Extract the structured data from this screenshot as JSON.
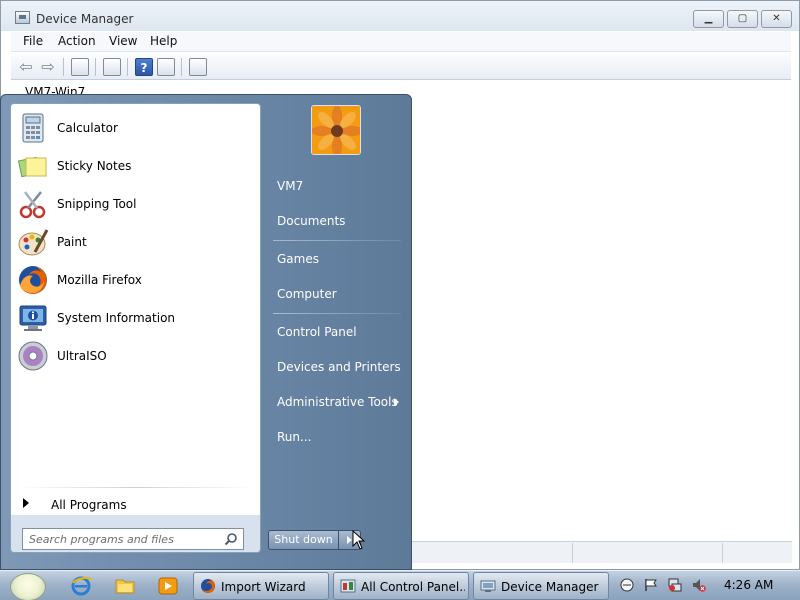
{
  "device_manager": {
    "title": "Device Manager",
    "menu": [
      "File",
      "Action",
      "View",
      "Help"
    ],
    "tree_root": "VM7-Win7",
    "buttons": {
      "minimize": "▁",
      "maximize": "▢",
      "close": "✕"
    }
  },
  "start_menu": {
    "programs": [
      {
        "label": "Calculator",
        "icon": "calculator-icon"
      },
      {
        "label": "Sticky Notes",
        "icon": "sticky-notes-icon"
      },
      {
        "label": "Snipping Tool",
        "icon": "snipping-tool-icon"
      },
      {
        "label": "Paint",
        "icon": "paint-icon"
      },
      {
        "label": "Mozilla Firefox",
        "icon": "firefox-icon"
      },
      {
        "label": "System Information",
        "icon": "system-information-icon"
      },
      {
        "label": "UltraISO",
        "icon": "ultraiso-icon"
      }
    ],
    "all_programs": "All Programs",
    "search_placeholder": "Search programs and files",
    "right_items": [
      "VM7",
      "Documents",
      "Games",
      "Computer",
      "Control Panel",
      "Devices and Printers",
      "Administrative Tools",
      "Run..."
    ],
    "shutdown": "Shut down"
  },
  "taskbar": {
    "tasks": [
      "Import Wizard",
      "All Control Panel...",
      "Device Manager"
    ],
    "clock": "4:26 AM"
  },
  "colors": {
    "start_menu_right": "#6a86a6",
    "taskbar": "#9fb3ca",
    "window_title": "#eef3f9"
  }
}
